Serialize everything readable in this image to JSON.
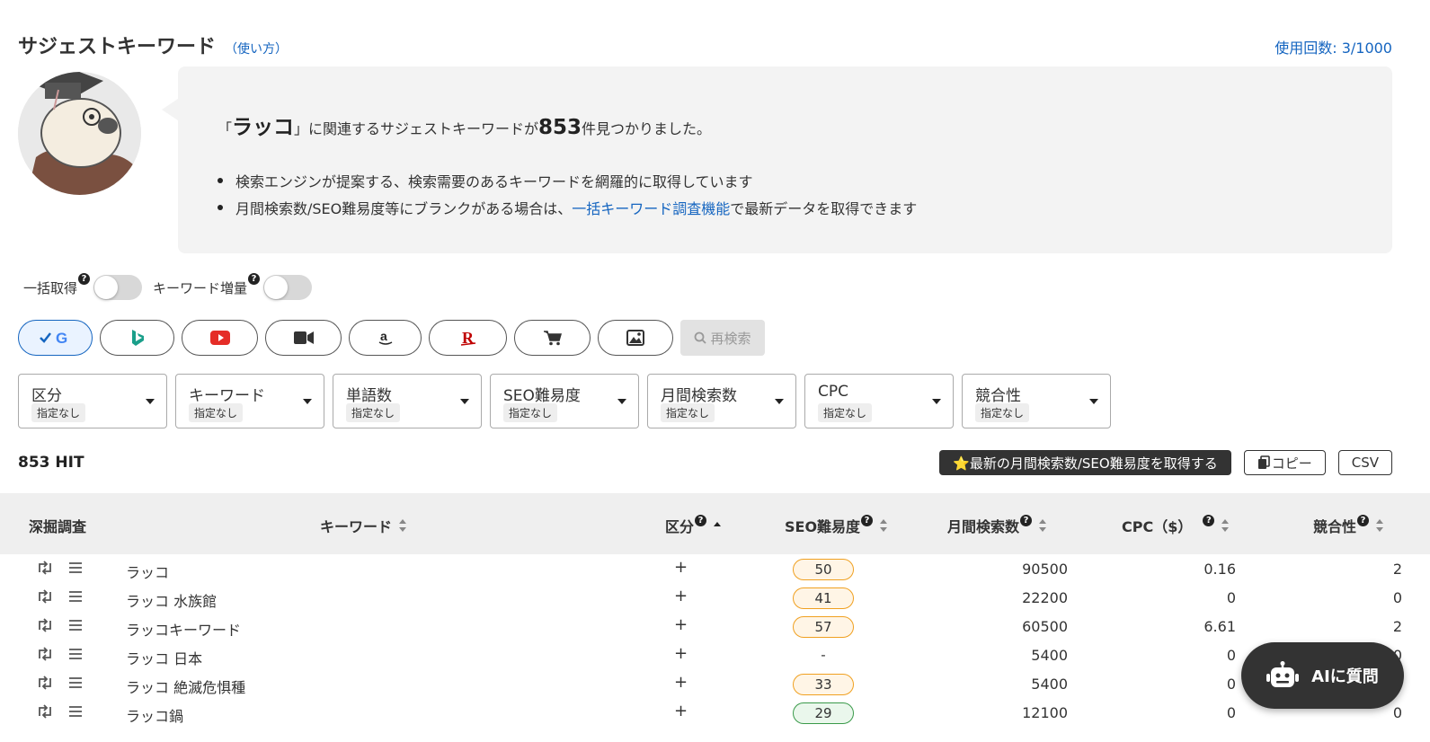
{
  "header": {
    "title": "サジェストキーワード",
    "howto": "（使い方）",
    "usage": "使用回数: 3/1000"
  },
  "bubble": {
    "pre": "「",
    "keyword": "ラッコ",
    "mid": "」に関連するサジェストキーワードが",
    "count": "853",
    "post": "件見つかりました。",
    "bullet1": "検索エンジンが提案する、検索需要のあるキーワードを網羅的に取得しています",
    "bullet2_pre": "月間検索数/SEO難易度等にブランクがある場合は、",
    "bullet2_link": "一括キーワード調査機能",
    "bullet2_post": "で最新データを取得できます"
  },
  "toggles": {
    "bulk": "一括取得",
    "expand": "キーワード増量",
    "help": "?"
  },
  "engines": [
    "google",
    "bing",
    "youtube",
    "video",
    "amazon",
    "rakuten",
    "shopping",
    "image"
  ],
  "research_label": "再検索",
  "filters": [
    {
      "label": "区分",
      "value": "指定なし"
    },
    {
      "label": "キーワード",
      "value": "指定なし"
    },
    {
      "label": "単語数",
      "value": "指定なし"
    },
    {
      "label": "SEO難易度",
      "value": "指定なし"
    },
    {
      "label": "月間検索数",
      "value": "指定なし"
    },
    {
      "label": "CPC",
      "value": "指定なし"
    },
    {
      "label": "競合性",
      "value": "指定なし"
    }
  ],
  "hits": "853 HIT",
  "actions": {
    "fetch": "⭐最新の月間検索数/SEO難易度を取得する",
    "copy": "コピー",
    "csv": "CSV"
  },
  "table": {
    "headers": {
      "dig": "深掘調査",
      "keyword": "キーワード",
      "category": "区分",
      "seo": "SEO難易度",
      "volume": "月間検索数",
      "cpc": "CPC（$）",
      "comp": "競合性"
    },
    "rows": [
      {
        "keyword": "ラッコ",
        "cat": "+",
        "seo": "50",
        "seo_color": "#f0a020",
        "seo_bg": "#fff5e6",
        "volume": "90500",
        "cpc": "0.16",
        "comp": "2"
      },
      {
        "keyword": "ラッコ 水族館",
        "cat": "+",
        "seo": "41",
        "seo_color": "#f0a020",
        "seo_bg": "#fff5e6",
        "volume": "22200",
        "cpc": "0",
        "comp": "0"
      },
      {
        "keyword": "ラッコキーワード",
        "cat": "+",
        "seo": "57",
        "seo_color": "#f0a020",
        "seo_bg": "#fff5e6",
        "volume": "60500",
        "cpc": "6.61",
        "comp": "2"
      },
      {
        "keyword": "ラッコ 日本",
        "cat": "+",
        "seo": "-",
        "seo_color": "",
        "seo_bg": "",
        "volume": "5400",
        "cpc": "0",
        "comp": "0"
      },
      {
        "keyword": "ラッコ 絶滅危惧種",
        "cat": "+",
        "seo": "33",
        "seo_color": "#f0a020",
        "seo_bg": "#fff5e6",
        "volume": "5400",
        "cpc": "0",
        "comp": ""
      },
      {
        "keyword": "ラッコ鍋",
        "cat": "+",
        "seo": "29",
        "seo_color": "#3a9a4a",
        "seo_bg": "#eaf7ec",
        "volume": "12100",
        "cpc": "0",
        "comp": "0"
      }
    ]
  },
  "ai_button": "AIに質問"
}
